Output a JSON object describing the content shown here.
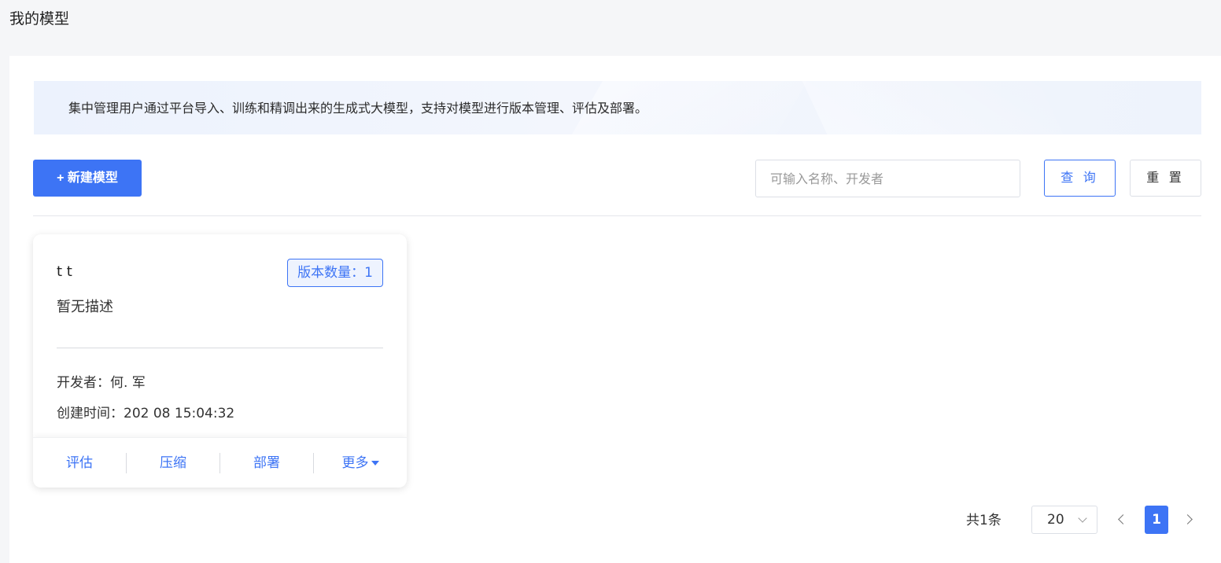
{
  "header": {
    "title": "我的模型"
  },
  "banner": {
    "text": "集中管理用户通过平台导入、训练和精调出来的生成式大模型，支持对模型进行版本管理、评估及部署。"
  },
  "toolbar": {
    "new_button": "+ 新建模型",
    "search_placeholder": "可输入名称、开发者",
    "search_value": "",
    "query_button": "查 询",
    "reset_button": "重 置"
  },
  "cards": [
    {
      "name": "t t",
      "version_badge": "版本数量：1",
      "description": "暂无描述",
      "developer": "开发者：何. 军",
      "created": "创建时间：202 08 15:04:32",
      "actions": {
        "evaluate": "评估",
        "compress": "压缩",
        "deploy": "部署",
        "more": "更多"
      }
    }
  ],
  "pagination": {
    "total": "共1条",
    "page_size": "20",
    "current_page": "1"
  },
  "colors": {
    "accent": "#3d74f5",
    "page_bg": "#f5f6f8",
    "banner_bg": "#ecf2fd"
  },
  "icons": {
    "more_caret": "caret-down-icon",
    "page_size_chevron": "chevron-down-icon",
    "prev": "chevron-left-icon",
    "next": "chevron-right-icon"
  }
}
